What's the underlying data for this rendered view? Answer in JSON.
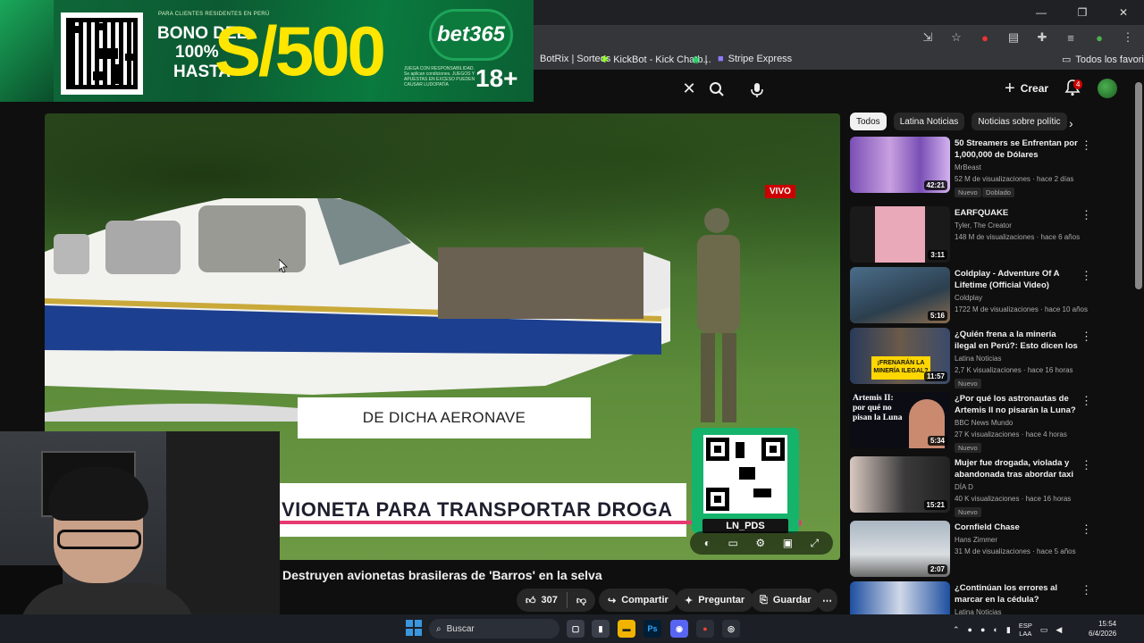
{
  "bookmarks": {
    "items": [
      "BotRix | Sorteos",
      "KickBot - Kick Chatb...",
      "|",
      "Stripe Express"
    ],
    "folder": "Todos los favoritos"
  },
  "masthead": {
    "create_label": "Crear",
    "notifications_count": "4"
  },
  "ad": {
    "small_text": "PARA CLIENTES RESIDENTES EN PERÚ",
    "bono_line1": "BONO DEL",
    "bono_line2": "100%",
    "hasta": "HASTA",
    "amount": "S/500",
    "brand": "bet365",
    "age": "18+",
    "responsible": "JUEGA CON RESPONSABILIDAD. Se aplican condiciones. JUEGOS Y APUESTAS EN EXCESO PUEDEN CAUSAR LUDOPATÍA"
  },
  "player": {
    "live_badge": "VIVO",
    "caption": "DE DICHA AERONAVE",
    "headline": "VIONETA PARA TRANSPORTAR DROGA",
    "qr_tag": "LN_PDS"
  },
  "video": {
    "title": "Destruyen avionetas brasileras de 'Barros' en la selva",
    "likes": "307",
    "share_label": "Compartir",
    "ask_label": "Preguntar",
    "save_label": "Guardar"
  },
  "chips": [
    "Todos",
    "Latina Noticias",
    "Noticias sobre polític"
  ],
  "recommendations": [
    {
      "title": "50 Streamers se Enfrentan por 1,000,000 de Dólares",
      "channel": "MrBeast",
      "meta": "52 M de visualizaciones · hace 2 días",
      "duration": "42:21",
      "badge": "Nuevo",
      "badge2": "Doblado"
    },
    {
      "title": "EARFQUAKE",
      "channel": "Tyler, The Creator",
      "meta": "148 M de visualizaciones · hace 6 años",
      "duration": "3:11"
    },
    {
      "title": "Coldplay - Adventure Of A Lifetime (Official Video)",
      "channel": "Coldplay",
      "meta": "1722 M de visualizaciones · hace 10 años",
      "duration": "5:16"
    },
    {
      "title": "¿Quién frena a la minería ilegal en Perú?: Esto dicen los ...",
      "channel": "Latina Noticias",
      "meta": "2,7 K visualizaciones · hace 16 horas",
      "duration": "11:57",
      "badge": "Nuevo",
      "thumb_text": "¡FRENARÁN LA MINERÍA ILEGAL?"
    },
    {
      "title": "¿Por qué los astronautas de Artemis II no pisarán la Luna? ...",
      "channel": "BBC News Mundo",
      "meta": "27 K visualizaciones · hace 4 horas",
      "duration": "5:34",
      "badge": "Nuevo",
      "thumb_text": "Artemis II: por qué no pisan la Luna"
    },
    {
      "title": "Mujer fue drogada, violada y abandonada tras abordar taxi",
      "channel": "DÍA D",
      "meta": "40 K visualizaciones · hace 16 horas",
      "duration": "15:21",
      "badge": "Nuevo"
    },
    {
      "title": "Cornfield Chase",
      "channel": "Hans Zimmer",
      "meta": "31 M de visualizaciones · hace 5 años",
      "duration": "2:07"
    },
    {
      "title": "¿Continúan los errores al marcar en la cédula? Peruano...",
      "channel": "Latina Noticias",
      "meta": "",
      "duration": ""
    }
  ],
  "taskbar": {
    "search_label": "Buscar",
    "lang_line1": "ESP",
    "lang_line2": "LAA",
    "time": "15:54",
    "date": "6/4/2026"
  },
  "colors": {
    "accent_red": "#cc0000",
    "progress_pink": "#e53970",
    "ad_green": "#0c5a32",
    "ad_yellow": "#ffe600"
  }
}
